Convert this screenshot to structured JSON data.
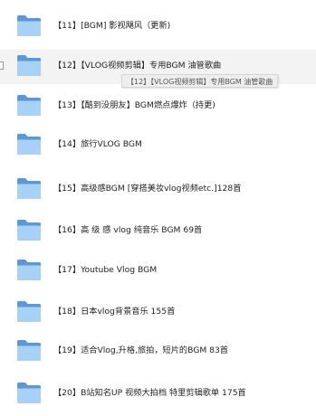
{
  "colors": {
    "folder_back": "#5d97d6",
    "folder_front": "#a7d1f7",
    "folder_edge": "#7fb3e6",
    "row_hover_bg": "#f3f3f3"
  },
  "folder_icon": "folder-icon",
  "hovered_index": 1,
  "tooltip": "【12】【VLOG视频剪辑】专用BGM 油管歌曲",
  "items": [
    {
      "label": "【11】[BGM] 影视飓风（更新)"
    },
    {
      "label": "【12】【VLOG视频剪辑】专用BGM 油管歌曲"
    },
    {
      "label": "【13】【酷到没朋友】BGM燃点爆炸（持更)"
    },
    {
      "label": "【14】旅行VLOG BGM"
    },
    {
      "label": "【15】高级感BGM [穿搭美妆vlog视频etc.]128首"
    },
    {
      "label": "【16】高 级 感 vlog 纯音乐 BGM  69首"
    },
    {
      "label": "【17】Youtube Vlog BGM"
    },
    {
      "label": "【18】日本vlog背景音乐 155首"
    },
    {
      "label": "【19】适合Vlog,升格,旅拍，短片的BGM  83首"
    },
    {
      "label": "【20】B站知名UP 视频大拍档 特里剪辑歌单 175首"
    }
  ]
}
